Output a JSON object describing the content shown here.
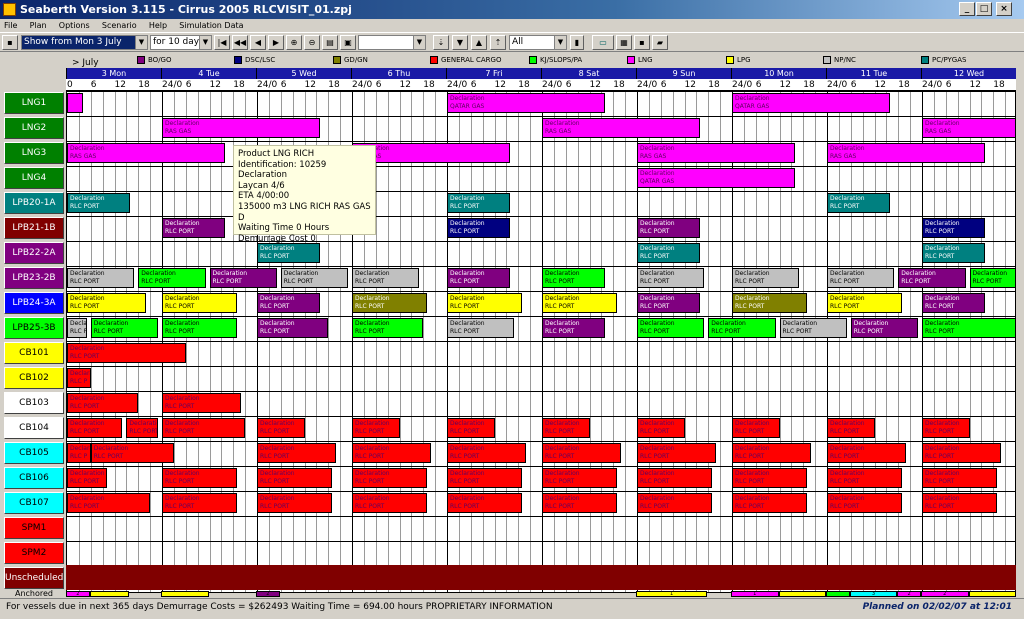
{
  "window": {
    "title": "Seaberth Version 3.115 - Cirrus 2005 RLCVISIT_01.zpj"
  },
  "menu": [
    "File",
    "Plan",
    "Options",
    "Scenario",
    "Help",
    "Simulation Data"
  ],
  "toolbar": {
    "show_from": "Show from Mon 3 July",
    "period": "for 10 days",
    "filter": "All"
  },
  "legend": {
    "header": "> July",
    "items": [
      {
        "label": "BO/GO",
        "color": "#800080"
      },
      {
        "label": "DSC/LSC",
        "color": "#000080"
      },
      {
        "label": "GD/GN",
        "color": "#808000"
      },
      {
        "label": "GENERAL CARGO",
        "color": "#ff0000"
      },
      {
        "label": "KJ/SLOPS/PA",
        "color": "#00ff00"
      },
      {
        "label": "LNG",
        "color": "#ff00ff"
      },
      {
        "label": "LPG",
        "color": "#ffff00"
      },
      {
        "label": "NP/NC",
        "color": "#c0c0c0"
      },
      {
        "label": "PC/PYGAS",
        "color": "#008080"
      }
    ]
  },
  "days": [
    "3 Mon",
    "4 Tue",
    "5 Wed",
    "6 Thu",
    "7 Fri",
    "8 Sat",
    "9 Sun",
    "10 Mon",
    "11 Tue",
    "12 Wed"
  ],
  "hour_labels": [
    "0",
    "6",
    "12",
    "18",
    "24/0",
    "6",
    "12",
    "18",
    "24/0",
    "6",
    "12",
    "18",
    "24/0",
    "6",
    "12",
    "18",
    "24/0",
    "6",
    "12",
    "18",
    "24/0",
    "6",
    "12",
    "18",
    "24/0",
    "6",
    "12",
    "18",
    "24/0",
    "6",
    "12",
    "18",
    "24/0",
    "6",
    "12",
    "18",
    "24/0",
    "6",
    "12",
    "18"
  ],
  "berths": [
    {
      "name": "LNG1",
      "color": "#008000",
      "text": "#ffffff"
    },
    {
      "name": "LNG2",
      "color": "#008000",
      "text": "#ffffff"
    },
    {
      "name": "LNG3",
      "color": "#008000",
      "text": "#ffffff"
    },
    {
      "name": "LNG4",
      "color": "#008000",
      "text": "#ffffff"
    },
    {
      "name": "LPB20-1A",
      "color": "#008080",
      "text": "#ffffff"
    },
    {
      "name": "LPB21-1B",
      "color": "#800000",
      "text": "#ffffff"
    },
    {
      "name": "LPB22-2A",
      "color": "#800080",
      "text": "#ffffff"
    },
    {
      "name": "LPB23-2B",
      "color": "#800080",
      "text": "#ffffff"
    },
    {
      "name": "LPB24-3A",
      "color": "#0000ff",
      "text": "#ffffff"
    },
    {
      "name": "LPB25-3B",
      "color": "#00ff00",
      "text": "#000000"
    },
    {
      "name": "CB101",
      "color": "#ffff00",
      "text": "#000000"
    },
    {
      "name": "CB102",
      "color": "#ffff00",
      "text": "#000000"
    },
    {
      "name": "CB103",
      "color": "#ffffff",
      "text": "#000000"
    },
    {
      "name": "CB104",
      "color": "#ffffff",
      "text": "#000000"
    },
    {
      "name": "CB105",
      "color": "#00ffff",
      "text": "#000000"
    },
    {
      "name": "CB106",
      "color": "#00ffff",
      "text": "#000000"
    },
    {
      "name": "CB107",
      "color": "#00ffff",
      "text": "#000000"
    },
    {
      "name": "SPM1",
      "color": "#ff0000",
      "text": "#000000"
    },
    {
      "name": "SPM2",
      "color": "#ff0000",
      "text": "#000000"
    },
    {
      "name": "Unscheduled",
      "color": "#800000",
      "text": "#ffffff"
    }
  ],
  "anchored_label": "Anchored",
  "bar_text": {
    "declaration": "Declaration",
    "rlc_port": "RLC PORT",
    "rlc_short": "RLC P",
    "qatar_gas": "QATAR GAS",
    "ras_gas": "RAS GAS",
    "anch_nums": [
      "2",
      "1",
      "1",
      "3",
      "2",
      "2"
    ]
  },
  "bars": [
    {
      "row": 0,
      "start": 0,
      "dur": 4,
      "color": "#ff00ff",
      "l1": "",
      "l2": ""
    },
    {
      "row": 0,
      "start": 96,
      "dur": 40,
      "color": "#ff00ff",
      "l1": "declaration",
      "l2": "qatar_gas"
    },
    {
      "row": 0,
      "start": 168,
      "dur": 40,
      "color": "#ff00ff",
      "l1": "declaration",
      "l2": "qatar_gas"
    },
    {
      "row": 1,
      "start": 24,
      "dur": 40,
      "color": "#ff00ff",
      "l1": "declaration",
      "l2": "ras_gas"
    },
    {
      "row": 1,
      "start": 120,
      "dur": 40,
      "color": "#ff00ff",
      "l1": "declaration",
      "l2": "ras_gas"
    },
    {
      "row": 1,
      "start": 216,
      "dur": 40,
      "color": "#ff00ff",
      "l1": "declaration",
      "l2": "ras_gas"
    },
    {
      "row": 2,
      "start": 0,
      "dur": 40,
      "color": "#ff00ff",
      "l1": "declaration",
      "l2": "ras_gas"
    },
    {
      "row": 2,
      "start": 72,
      "dur": 40,
      "color": "#ff00ff",
      "l1": "declaration",
      "l2": "ras_gas"
    },
    {
      "row": 2,
      "start": 144,
      "dur": 40,
      "color": "#ff00ff",
      "l1": "declaration",
      "l2": "ras_gas"
    },
    {
      "row": 2,
      "start": 192,
      "dur": 40,
      "color": "#ff00ff",
      "l1": "declaration",
      "l2": "ras_gas"
    },
    {
      "row": 3,
      "start": 144,
      "dur": 40,
      "color": "#ff00ff",
      "l1": "declaration",
      "l2": "qatar_gas"
    },
    {
      "row": 4,
      "start": 0,
      "dur": 16,
      "color": "#008080",
      "l1": "declaration",
      "l2": "rlc_port"
    },
    {
      "row": 4,
      "start": 96,
      "dur": 16,
      "color": "#008080",
      "l1": "declaration",
      "l2": "rlc_port"
    },
    {
      "row": 4,
      "start": 192,
      "dur": 16,
      "color": "#008080",
      "l1": "declaration",
      "l2": "rlc_port"
    },
    {
      "row": 5,
      "start": 24,
      "dur": 16,
      "color": "#800080",
      "l1": "declaration",
      "l2": "rlc_port"
    },
    {
      "row": 5,
      "start": 96,
      "dur": 16,
      "color": "#000080",
      "l1": "declaration",
      "l2": "rlc_port"
    },
    {
      "row": 5,
      "start": 144,
      "dur": 16,
      "color": "#800080",
      "l1": "declaration",
      "l2": "rlc_port"
    },
    {
      "row": 5,
      "start": 216,
      "dur": 16,
      "color": "#000080",
      "l1": "declaration",
      "l2": "rlc_port"
    },
    {
      "row": 6,
      "start": 48,
      "dur": 16,
      "color": "#008080",
      "l1": "declaration",
      "l2": "rlc_port"
    },
    {
      "row": 6,
      "start": 144,
      "dur": 16,
      "color": "#008080",
      "l1": "declaration",
      "l2": "rlc_port"
    },
    {
      "row": 6,
      "start": 216,
      "dur": 16,
      "color": "#008080",
      "l1": "declaration",
      "l2": "rlc_port"
    },
    {
      "row": 7,
      "start": 0,
      "dur": 17,
      "color": "#c0c0c0",
      "l1": "declaration",
      "l2": "rlc_port"
    },
    {
      "row": 7,
      "start": 18,
      "dur": 17,
      "color": "#00ff00",
      "l1": "declaration",
      "l2": "rlc_port"
    },
    {
      "row": 7,
      "start": 36,
      "dur": 17,
      "color": "#800080",
      "l1": "declaration",
      "l2": "rlc_port"
    },
    {
      "row": 7,
      "start": 54,
      "dur": 17,
      "color": "#c0c0c0",
      "l1": "declaration",
      "l2": "rlc_port"
    },
    {
      "row": 7,
      "start": 72,
      "dur": 17,
      "color": "#c0c0c0",
      "l1": "declaration",
      "l2": "rlc_port"
    },
    {
      "row": 7,
      "start": 96,
      "dur": 16,
      "color": "#800080",
      "l1": "declaration",
      "l2": "rlc_port"
    },
    {
      "row": 7,
      "start": 120,
      "dur": 16,
      "color": "#00ff00",
      "l1": "declaration",
      "l2": "rlc_port"
    },
    {
      "row": 7,
      "start": 144,
      "dur": 17,
      "color": "#c0c0c0",
      "l1": "declaration",
      "l2": "rlc_port"
    },
    {
      "row": 7,
      "start": 168,
      "dur": 17,
      "color": "#c0c0c0",
      "l1": "declaration",
      "l2": "rlc_port"
    },
    {
      "row": 7,
      "start": 192,
      "dur": 17,
      "color": "#c0c0c0",
      "l1": "declaration",
      "l2": "rlc_port"
    },
    {
      "row": 7,
      "start": 210,
      "dur": 17,
      "color": "#800080",
      "l1": "declaration",
      "l2": "rlc_port"
    },
    {
      "row": 7,
      "start": 228,
      "dur": 12,
      "color": "#00ff00",
      "l1": "declaration",
      "l2": "rlc_port"
    },
    {
      "row": 8,
      "start": 0,
      "dur": 20,
      "color": "#ffff00",
      "l1": "declaration",
      "l2": "rlc_port"
    },
    {
      "row": 8,
      "start": 24,
      "dur": 19,
      "color": "#ffff00",
      "l1": "declaration",
      "l2": "rlc_port"
    },
    {
      "row": 8,
      "start": 48,
      "dur": 16,
      "color": "#800080",
      "l1": "declaration",
      "l2": "rlc_port"
    },
    {
      "row": 8,
      "start": 72,
      "dur": 19,
      "color": "#808000",
      "l1": "declaration",
      "l2": "rlc_port"
    },
    {
      "row": 8,
      "start": 96,
      "dur": 19,
      "color": "#ffff00",
      "l1": "declaration",
      "l2": "rlc_port"
    },
    {
      "row": 8,
      "start": 120,
      "dur": 19,
      "color": "#ffff00",
      "l1": "declaration",
      "l2": "rlc_port"
    },
    {
      "row": 8,
      "start": 144,
      "dur": 16,
      "color": "#800080",
      "l1": "declaration",
      "l2": "rlc_port"
    },
    {
      "row": 8,
      "start": 168,
      "dur": 19,
      "color": "#808000",
      "l1": "declaration",
      "l2": "rlc_port"
    },
    {
      "row": 8,
      "start": 192,
      "dur": 19,
      "color": "#ffff00",
      "l1": "declaration",
      "l2": "rlc_port"
    },
    {
      "row": 8,
      "start": 216,
      "dur": 16,
      "color": "#800080",
      "l1": "declaration",
      "l2": "rlc_port"
    },
    {
      "row": 9,
      "start": 0,
      "dur": 5,
      "color": "#c0c0c0",
      "l1": "declaration",
      "l2": "rlc_short"
    },
    {
      "row": 9,
      "start": 6,
      "dur": 17,
      "color": "#00ff00",
      "l1": "declaration",
      "l2": "rlc_port"
    },
    {
      "row": 9,
      "start": 24,
      "dur": 19,
      "color": "#00ff00",
      "l1": "declaration",
      "l2": "rlc_port"
    },
    {
      "row": 9,
      "start": 48,
      "dur": 18,
      "color": "#800080",
      "l1": "declaration",
      "l2": "rlc_port"
    },
    {
      "row": 9,
      "start": 72,
      "dur": 18,
      "color": "#00ff00",
      "l1": "declaration",
      "l2": "rlc_port"
    },
    {
      "row": 9,
      "start": 96,
      "dur": 17,
      "color": "#c0c0c0",
      "l1": "declaration",
      "l2": "rlc_port"
    },
    {
      "row": 9,
      "start": 120,
      "dur": 16,
      "color": "#800080",
      "l1": "declaration",
      "l2": "rlc_port"
    },
    {
      "row": 9,
      "start": 144,
      "dur": 17,
      "color": "#00ff00",
      "l1": "declaration",
      "l2": "rlc_port"
    },
    {
      "row": 9,
      "start": 162,
      "dur": 17,
      "color": "#00ff00",
      "l1": "declaration",
      "l2": "rlc_port"
    },
    {
      "row": 9,
      "start": 180,
      "dur": 17,
      "color": "#c0c0c0",
      "l1": "declaration",
      "l2": "rlc_port"
    },
    {
      "row": 9,
      "start": 198,
      "dur": 17,
      "color": "#800080",
      "l1": "declaration",
      "l2": "rlc_port"
    },
    {
      "row": 9,
      "start": 216,
      "dur": 24,
      "color": "#00ff00",
      "l1": "declaration",
      "l2": "rlc_port"
    },
    {
      "row": 10,
      "start": 0,
      "dur": 30,
      "color": "#ff0000",
      "l1": "declaration",
      "l2": "rlc_port"
    },
    {
      "row": 11,
      "start": 0,
      "dur": 6,
      "color": "#ff0000",
      "l1": "declaration",
      "l2": "rlc_short"
    },
    {
      "row": 12,
      "start": 0,
      "dur": 18,
      "color": "#ff0000",
      "l1": "declaration",
      "l2": "rlc_port"
    },
    {
      "row": 12,
      "start": 24,
      "dur": 20,
      "color": "#ff0000",
      "l1": "declaration",
      "l2": "rlc_port"
    },
    {
      "row": 13,
      "start": 0,
      "dur": 14,
      "color": "#ff0000",
      "l1": "declaration",
      "l2": "rlc_port"
    },
    {
      "row": 13,
      "start": 15,
      "dur": 8,
      "color": "#ff0000",
      "l1": "declaration",
      "l2": "rlc_port"
    },
    {
      "row": 13,
      "start": 24,
      "dur": 21,
      "color": "#ff0000",
      "l1": "declaration",
      "l2": "rlc_port"
    },
    {
      "row": 13,
      "start": 48,
      "dur": 12,
      "color": "#ff0000",
      "l1": "declaration",
      "l2": "rlc_port"
    },
    {
      "row": 13,
      "start": 72,
      "dur": 12,
      "color": "#ff0000",
      "l1": "declaration",
      "l2": "rlc_port"
    },
    {
      "row": 13,
      "start": 96,
      "dur": 12,
      "color": "#ff0000",
      "l1": "declaration",
      "l2": "rlc_port"
    },
    {
      "row": 13,
      "start": 120,
      "dur": 12,
      "color": "#ff0000",
      "l1": "declaration",
      "l2": "rlc_port"
    },
    {
      "row": 13,
      "start": 144,
      "dur": 12,
      "color": "#ff0000",
      "l1": "declaration",
      "l2": "rlc_port"
    },
    {
      "row": 13,
      "start": 168,
      "dur": 12,
      "color": "#ff0000",
      "l1": "declaration",
      "l2": "rlc_port"
    },
    {
      "row": 13,
      "start": 192,
      "dur": 12,
      "color": "#ff0000",
      "l1": "declaration",
      "l2": "rlc_port"
    },
    {
      "row": 13,
      "start": 216,
      "dur": 12,
      "color": "#ff0000",
      "l1": "declaration",
      "l2": "rlc_port"
    },
    {
      "row": 14,
      "start": 0,
      "dur": 6,
      "color": "#ff0000",
      "l1": "declaration",
      "l2": "rlc_short"
    },
    {
      "row": 14,
      "start": 6,
      "dur": 21,
      "color": "#ff0000",
      "l1": "declaration",
      "l2": "rlc_port"
    },
    {
      "row": 14,
      "start": 48,
      "dur": 20,
      "color": "#ff0000",
      "l1": "declaration",
      "l2": "rlc_port"
    },
    {
      "row": 14,
      "start": 72,
      "dur": 20,
      "color": "#ff0000",
      "l1": "declaration",
      "l2": "rlc_port"
    },
    {
      "row": 14,
      "start": 96,
      "dur": 20,
      "color": "#ff0000",
      "l1": "declaration",
      "l2": "rlc_port"
    },
    {
      "row": 14,
      "start": 120,
      "dur": 20,
      "color": "#ff0000",
      "l1": "declaration",
      "l2": "rlc_port"
    },
    {
      "row": 14,
      "start": 144,
      "dur": 20,
      "color": "#ff0000",
      "l1": "declaration",
      "l2": "rlc_port"
    },
    {
      "row": 14,
      "start": 168,
      "dur": 20,
      "color": "#ff0000",
      "l1": "declaration",
      "l2": "rlc_port"
    },
    {
      "row": 14,
      "start": 192,
      "dur": 20,
      "color": "#ff0000",
      "l1": "declaration",
      "l2": "rlc_port"
    },
    {
      "row": 14,
      "start": 216,
      "dur": 20,
      "color": "#ff0000",
      "l1": "declaration",
      "l2": "rlc_port"
    },
    {
      "row": 15,
      "start": 0,
      "dur": 10,
      "color": "#ff0000",
      "l1": "declaration",
      "l2": "rlc_port"
    },
    {
      "row": 15,
      "start": 24,
      "dur": 19,
      "color": "#ff0000",
      "l1": "declaration",
      "l2": "rlc_port"
    },
    {
      "row": 15,
      "start": 48,
      "dur": 19,
      "color": "#ff0000",
      "l1": "declaration",
      "l2": "rlc_port"
    },
    {
      "row": 15,
      "start": 72,
      "dur": 19,
      "color": "#ff0000",
      "l1": "declaration",
      "l2": "rlc_port"
    },
    {
      "row": 15,
      "start": 96,
      "dur": 19,
      "color": "#ff0000",
      "l1": "declaration",
      "l2": "rlc_port"
    },
    {
      "row": 15,
      "start": 120,
      "dur": 19,
      "color": "#ff0000",
      "l1": "declaration",
      "l2": "rlc_port"
    },
    {
      "row": 15,
      "start": 144,
      "dur": 19,
      "color": "#ff0000",
      "l1": "declaration",
      "l2": "rlc_port"
    },
    {
      "row": 15,
      "start": 168,
      "dur": 19,
      "color": "#ff0000",
      "l1": "declaration",
      "l2": "rlc_port"
    },
    {
      "row": 15,
      "start": 192,
      "dur": 19,
      "color": "#ff0000",
      "l1": "declaration",
      "l2": "rlc_port"
    },
    {
      "row": 15,
      "start": 216,
      "dur": 19,
      "color": "#ff0000",
      "l1": "declaration",
      "l2": "rlc_port"
    },
    {
      "row": 16,
      "start": 0,
      "dur": 21,
      "color": "#ff0000",
      "l1": "declaration",
      "l2": "rlc_port"
    },
    {
      "row": 16,
      "start": 24,
      "dur": 19,
      "color": "#ff0000",
      "l1": "declaration",
      "l2": "rlc_port"
    },
    {
      "row": 16,
      "start": 48,
      "dur": 19,
      "color": "#ff0000",
      "l1": "declaration",
      "l2": "rlc_port"
    },
    {
      "row": 16,
      "start": 72,
      "dur": 19,
      "color": "#ff0000",
      "l1": "declaration",
      "l2": "rlc_port"
    },
    {
      "row": 16,
      "start": 96,
      "dur": 19,
      "color": "#ff0000",
      "l1": "declaration",
      "l2": "rlc_port"
    },
    {
      "row": 16,
      "start": 120,
      "dur": 19,
      "color": "#ff0000",
      "l1": "declaration",
      "l2": "rlc_port"
    },
    {
      "row": 16,
      "start": 144,
      "dur": 19,
      "color": "#ff0000",
      "l1": "declaration",
      "l2": "rlc_port"
    },
    {
      "row": 16,
      "start": 168,
      "dur": 19,
      "color": "#ff0000",
      "l1": "declaration",
      "l2": "rlc_port"
    },
    {
      "row": 16,
      "start": 192,
      "dur": 19,
      "color": "#ff0000",
      "l1": "declaration",
      "l2": "rlc_port"
    },
    {
      "row": 16,
      "start": 216,
      "dur": 19,
      "color": "#ff0000",
      "l1": "declaration",
      "l2": "rlc_port"
    }
  ],
  "anchored": [
    {
      "start": 0,
      "dur": 6,
      "color": "#ff00ff",
      "label": "2"
    },
    {
      "start": 6,
      "dur": 10,
      "color": "#ffff00",
      "label": ""
    },
    {
      "start": 24,
      "dur": 12,
      "color": "#ffff00",
      "label": ""
    },
    {
      "start": 48,
      "dur": 6,
      "color": "#800080",
      "label": "2"
    },
    {
      "start": 144,
      "dur": 18,
      "color": "#ffff00",
      "label": "1"
    },
    {
      "start": 168,
      "dur": 12,
      "color": "#ff00ff",
      "label": "1"
    },
    {
      "start": 180,
      "dur": 12,
      "color": "#ffff00",
      "label": ""
    },
    {
      "start": 192,
      "dur": 6,
      "color": "#00ff00",
      "label": ""
    },
    {
      "start": 198,
      "dur": 12,
      "color": "#00ffff",
      "label": "3"
    },
    {
      "start": 210,
      "dur": 6,
      "color": "#ff00ff",
      "label": "2"
    },
    {
      "start": 216,
      "dur": 12,
      "color": "#ff00ff",
      "label": "2"
    },
    {
      "start": 228,
      "dur": 12,
      "color": "#ffff00",
      "label": ""
    }
  ],
  "tooltip": [
    "Product LNG RICH",
    "Identification:  10259",
    "Declaration",
    "Laycan 4/6",
    "ETA 4/00:00",
    "135000 m3 LNG RICH RAS GAS D",
    "Waiting Time 0 Hours",
    "Demurrage Cost 0"
  ],
  "status": {
    "left": "For vessels due in next 365 days Demurrage Costs = $262493  Waiting Time =  694.00 hours  PROPRIETARY INFORMATION",
    "right": "Planned on 02/02/07 at 12:01"
  }
}
